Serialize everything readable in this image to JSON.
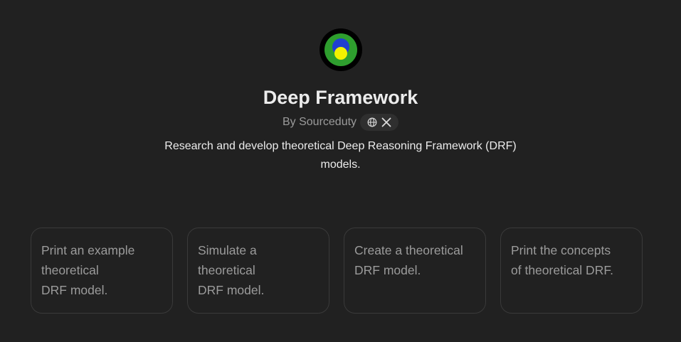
{
  "gpt": {
    "name": "Deep Framework",
    "author_prefix": "By",
    "author": "Sourceduty",
    "description": "Research and develop theoretical Deep Reasoning Framework (DRF) models.",
    "links": [
      {
        "icon": "globe-icon"
      },
      {
        "icon": "x-logo-icon"
      }
    ]
  },
  "conversation_starters": [
    {
      "label": "Print an example\ntheoretical\nDRF model."
    },
    {
      "label": "Simulate a\ntheoretical\nDRF model."
    },
    {
      "label": "Create a theoretical\nDRF model."
    },
    {
      "label": "Print the concepts\nof theoretical DRF."
    }
  ],
  "colors": {
    "background": "#212121",
    "text_primary": "#ececec",
    "text_secondary": "#9b9b9b",
    "card_border": "#3a3a3a",
    "avatar_ring": "#000000",
    "avatar_green": "#2e9e2e",
    "avatar_blue": "#1f3fd1",
    "avatar_yellow": "#f2f200"
  }
}
